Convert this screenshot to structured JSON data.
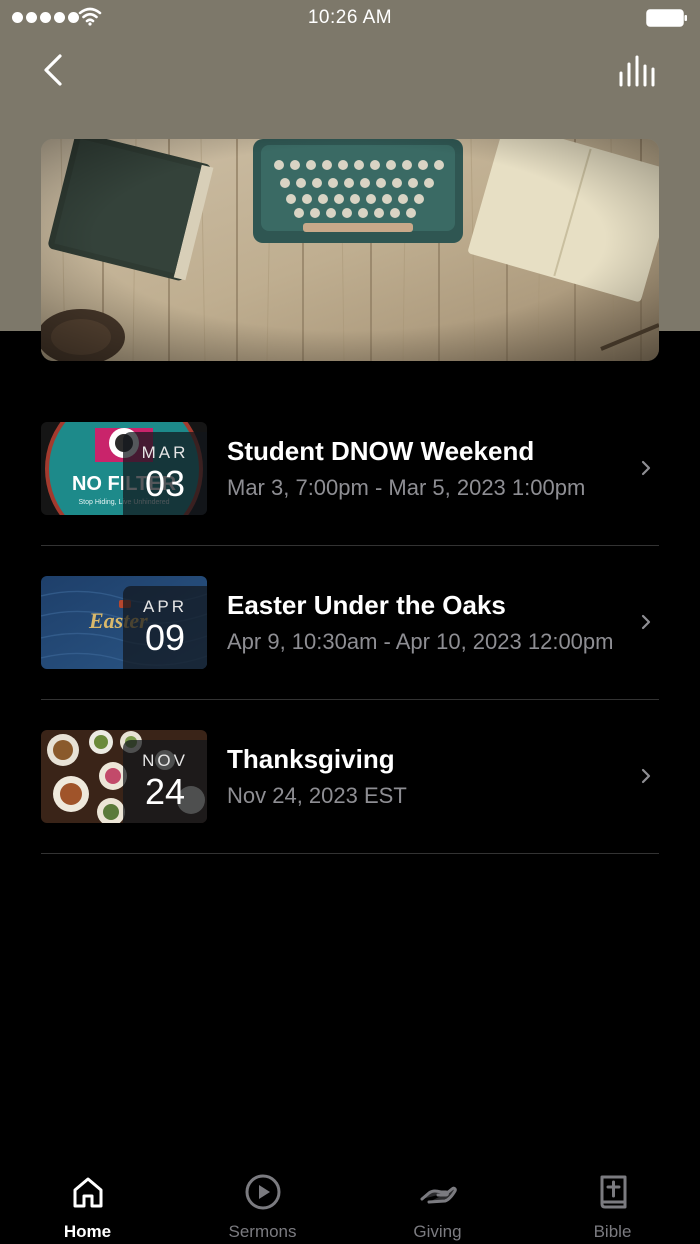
{
  "status_bar": {
    "time": "10:26 AM"
  },
  "nav": {
    "back_icon": "chevron-left-icon",
    "audio_icon": "audio-bars-icon"
  },
  "hero": {
    "image": "typewriter-desk-photo"
  },
  "events": [
    {
      "month": "MAR",
      "day": "03",
      "title": "Student DNOW Weekend",
      "subtitle": "Mar 3, 7:00pm - Mar 5, 2023 1:00pm",
      "thumb_text": "NO FILTER",
      "thumb_caption": "Stop Hiding, Live Unhindered"
    },
    {
      "month": "APR",
      "day": "09",
      "title": "Easter Under the Oaks",
      "subtitle": "Apr 9, 10:30am - Apr 10, 2023 12:00pm",
      "thumb_text": "Easter"
    },
    {
      "month": "NOV",
      "day": "24",
      "title": "Thanksgiving",
      "subtitle": "Nov 24, 2023 EST"
    }
  ],
  "tabs": [
    {
      "label": "Home",
      "icon": "home-icon",
      "active": true
    },
    {
      "label": "Sermons",
      "icon": "play-circle-icon",
      "active": false
    },
    {
      "label": "Giving",
      "icon": "giving-hand-icon",
      "active": false
    },
    {
      "label": "Bible",
      "icon": "bible-icon",
      "active": false
    }
  ],
  "colors": {
    "background": "#000000",
    "header_band": "#7d786a",
    "subtitle": "#8e8e93",
    "tab_inactive": "#7b7b80"
  }
}
